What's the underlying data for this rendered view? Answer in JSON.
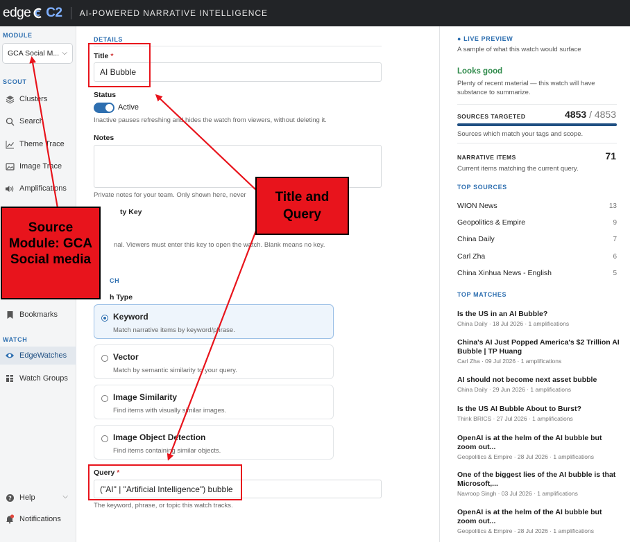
{
  "topbar": {
    "brand_edge": "edge",
    "brand_c2": "C2",
    "tagline": "AI-POWERED NARRATIVE INTELLIGENCE"
  },
  "sidebar": {
    "module_label": "MODULE",
    "module_value": "GCA Social M...",
    "scout_label": "SCOUT",
    "scout_items": [
      {
        "label": "Clusters",
        "icon": "layers-icon"
      },
      {
        "label": "Search",
        "icon": "search-icon"
      },
      {
        "label": "Theme Trace",
        "icon": "chart-line-icon"
      },
      {
        "label": "Image Trace",
        "icon": "image-icon"
      },
      {
        "label": "Amplifications",
        "icon": "speaker-icon"
      }
    ],
    "bookmarks_label": "Bookmarks",
    "watch_label": "WATCH",
    "watch_items": [
      {
        "label": "EdgeWatches",
        "icon": "eye-icon"
      },
      {
        "label": "Watch Groups",
        "icon": "grid-icon"
      }
    ],
    "help_label": "Help",
    "notifications_label": "Notifications"
  },
  "form": {
    "details_label": "DETAILS",
    "title_label": "Title",
    "title_value": "AI Bubble",
    "status_label": "Status",
    "status_value": "Active",
    "status_hint": "Inactive pauses refreshing and hides the watch from viewers, without deleting it.",
    "notes_label": "Notes",
    "notes_hint": "Private notes for your team. Only shown here, never",
    "key_label": "ty Key",
    "key_hint": "nal. Viewers must enter this key to open the watch. Blank means no key.",
    "search_label": "CH",
    "type_label": "h Type",
    "options": [
      {
        "title": "Keyword",
        "desc": "Match narrative items by keyword/phrase.",
        "selected": true
      },
      {
        "title": "Vector",
        "desc": "Match by semantic similarity to your query.",
        "selected": false
      },
      {
        "title": "Image Similarity",
        "desc": "Find items with visually similar images.",
        "selected": false
      },
      {
        "title": "Image Object Detection",
        "desc": "Find items containing similar objects.",
        "selected": false
      }
    ],
    "query_label": "Query",
    "query_value": "(\"AI\" | \"Artificial Intelligence\") bubble",
    "query_hint": "The keyword, phrase, or topic this watch tracks.",
    "required_mark": "*"
  },
  "preview": {
    "live_label": "● LIVE PREVIEW",
    "live_desc": "A sample of what this watch would surface",
    "status_title": "Looks good",
    "status_desc_1": "Plenty of recent material — this watch will have",
    "status_desc_2": "substance to summarize.",
    "sources_label": "SOURCES TARGETED",
    "sources_value": "4853",
    "sources_total": "/ 4853",
    "sources_fill": 1.0,
    "sources_desc": "Sources which match your tags and scope.",
    "items_label": "NARRATIVE ITEMS",
    "items_value": "71",
    "items_desc": "Current items matching the current query.",
    "top_sources_label": "TOP SOURCES",
    "top_sources": [
      {
        "name": "WION News",
        "count": "13"
      },
      {
        "name": "Geopolitics & Empire",
        "count": "9"
      },
      {
        "name": "China Daily",
        "count": "7"
      },
      {
        "name": "Carl Zha",
        "count": "6"
      },
      {
        "name": "China Xinhua News - English",
        "count": "5"
      }
    ],
    "top_matches_label": "TOP MATCHES",
    "top_matches": [
      {
        "title": "Is the US in an AI Bubble?",
        "meta": "China Daily · 18 Jul 2026 · 1 amplifications"
      },
      {
        "title": "China's AI Just Popped America's $2 Trillion AI Bubble | TP Huang",
        "meta": "Carl Zha · 09 Jul 2026 · 1 amplifications"
      },
      {
        "title": "AI should not become next asset bubble",
        "meta": "China Daily · 29 Jun 2026 · 1 amplifications"
      },
      {
        "title": "Is the US AI Bubble About to Burst?",
        "meta": "Think BRICS · 27 Jul 2026 · 1 amplifications"
      },
      {
        "title": "OpenAI is at the helm of the AI bubble but zoom out...",
        "meta": "Geopolitics & Empire · 28 Jul 2026 · 1 amplifications"
      },
      {
        "title": "One of the biggest lies of the AI bubble is that Microsoft,...",
        "meta": "Navroop Singh · 03 Jul 2026 · 1 amplifications"
      },
      {
        "title": "OpenAI is at the helm of the AI bubble but zoom out...",
        "meta": "Geopolitics & Empire · 28 Jul 2026 · 1 amplifications"
      }
    ]
  },
  "annotations": {
    "source_callout": "Source Module: GCA Social media",
    "title_callout": "Title and Query",
    "color": "#e8141c"
  }
}
